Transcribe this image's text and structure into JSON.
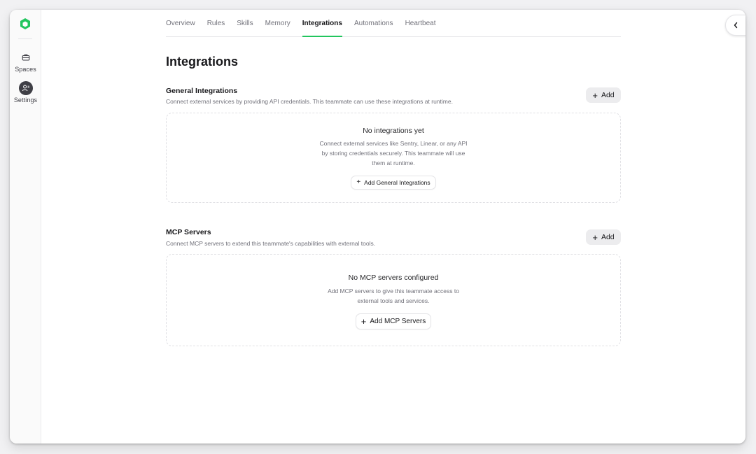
{
  "sidebar": {
    "items": [
      {
        "label": "Spaces",
        "icon": "briefcase-icon"
      },
      {
        "label": "Settings",
        "icon": "user-settings-icon"
      }
    ]
  },
  "tabs": [
    {
      "label": "Overview"
    },
    {
      "label": "Rules"
    },
    {
      "label": "Skills"
    },
    {
      "label": "Memory"
    },
    {
      "label": "Integrations",
      "active": true
    },
    {
      "label": "Automations"
    },
    {
      "label": "Heartbeat"
    }
  ],
  "page": {
    "title": "Integrations"
  },
  "general": {
    "title": "General Integrations",
    "description": "Connect external services by providing API credentials. This teammate can use these integrations at runtime.",
    "add_label": "Add",
    "empty_title": "No integrations yet",
    "empty_line1": "Connect external services like Sentry, Linear, or any API",
    "empty_line2": "by storing credentials securely. This teammate will use",
    "empty_line3": "them at runtime.",
    "empty_button": "Add General Integrations"
  },
  "mcp": {
    "title": "MCP Servers",
    "description": "Connect MCP servers to extend this teammate's capabilities with external tools.",
    "add_label": "Add",
    "empty_title": "No MCP servers configured",
    "empty_line1": "Add MCP servers to give this teammate access to",
    "empty_line2": "external tools and services.",
    "empty_button": "Add MCP Servers"
  },
  "colors": {
    "accent": "#22c55e",
    "settings_icon_bg": "#3f3f46"
  }
}
